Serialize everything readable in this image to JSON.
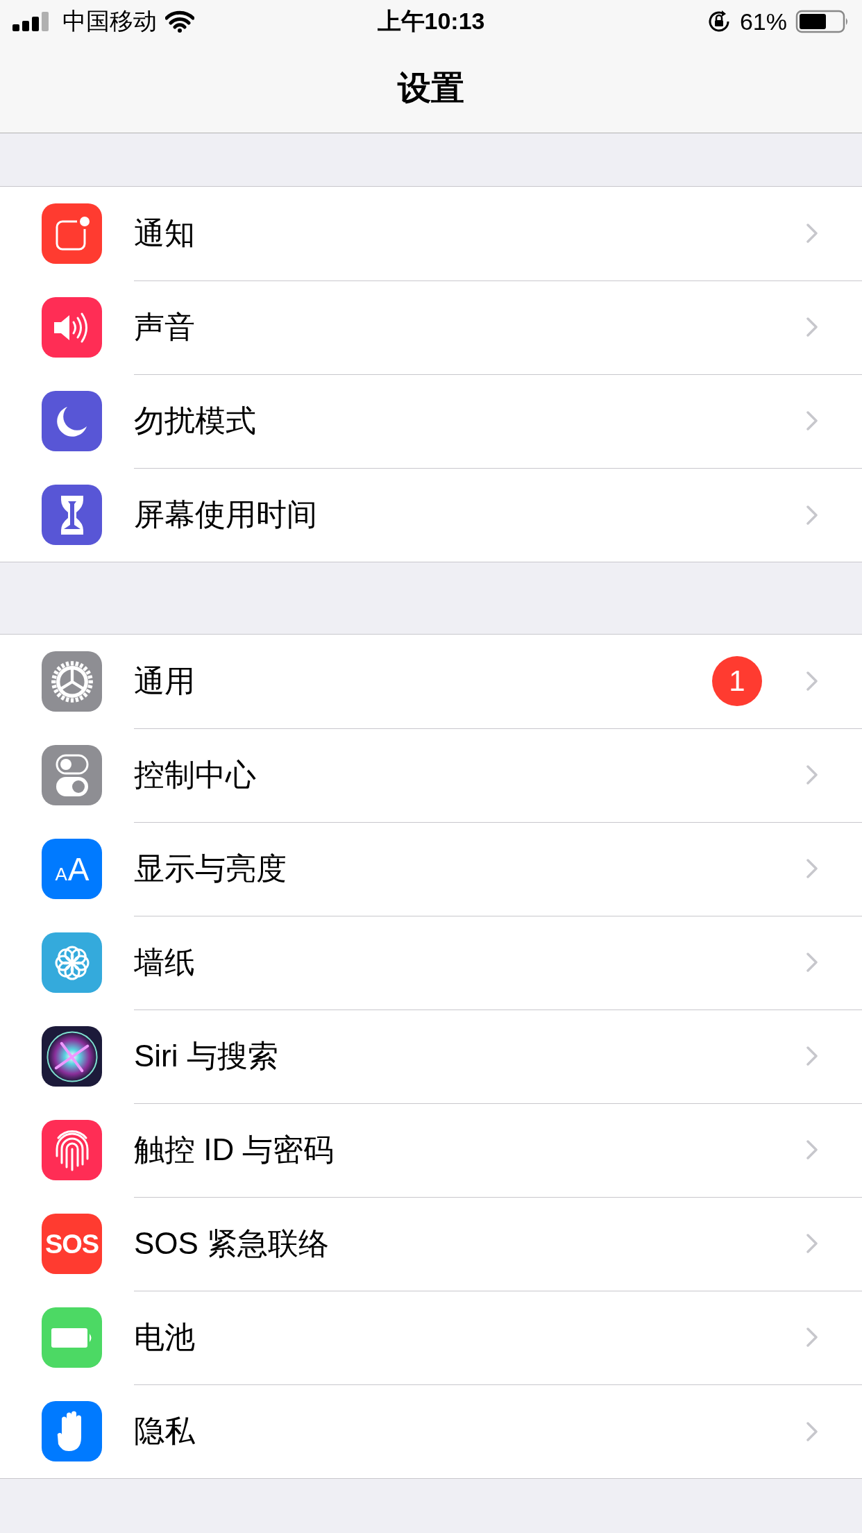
{
  "status_bar": {
    "carrier": "中国移动",
    "time": "上午10:13",
    "battery": "61%"
  },
  "nav_bar": {
    "title": "设置"
  },
  "groups": [
    {
      "items": [
        {
          "label": "通知",
          "kind": "notification",
          "color": "#ff3b30"
        },
        {
          "label": "声音",
          "kind": "sound",
          "color": "#ff2d55"
        },
        {
          "label": "勿扰模式",
          "kind": "moon",
          "color": "#5856d6"
        },
        {
          "label": "屏幕使用时间",
          "kind": "hourglass",
          "color": "#5856d6"
        }
      ]
    },
    {
      "items": [
        {
          "label": "通用",
          "kind": "gear",
          "color": "#8e8e93",
          "badge": "1"
        },
        {
          "label": "控制中心",
          "kind": "toggles",
          "color": "#8e8e93"
        },
        {
          "label": "显示与亮度",
          "kind": "letters",
          "color": "#007aff",
          "icon_text": [
            "A",
            "A"
          ]
        },
        {
          "label": "墙纸",
          "kind": "flower",
          "color": "#34aadc"
        },
        {
          "label": "Siri 与搜索",
          "kind": "orb",
          "color": "#1c1a3a"
        },
        {
          "label": "触控 ID 与密码",
          "kind": "fingerprint",
          "color": "#ff2d55"
        },
        {
          "label": "SOS 紧急联络",
          "kind": "text",
          "color": "#ff3b30",
          "icon_text": [
            "SOS"
          ]
        },
        {
          "label": "电池",
          "kind": "battery",
          "color": "#4cd964"
        },
        {
          "label": "隐私",
          "kind": "hand",
          "color": "#007aff"
        }
      ]
    }
  ]
}
